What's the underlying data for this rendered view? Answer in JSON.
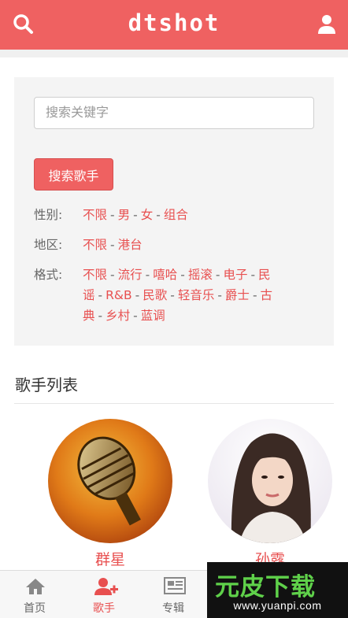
{
  "header": {
    "title": "dtshot"
  },
  "search": {
    "placeholder": "搜索关键字",
    "button_label": "搜索歌手"
  },
  "filters": {
    "gender": {
      "label": "性别:",
      "options": [
        "不限",
        "男",
        "女",
        "组合"
      ]
    },
    "region": {
      "label": "地区:",
      "options": [
        "不限",
        "港台"
      ]
    },
    "style": {
      "label": "格式:",
      "options": [
        "不限",
        "流行",
        "嘻哈",
        "摇滚",
        "电子",
        "民谣",
        "R&B",
        "民歌",
        "轻音乐",
        "爵士",
        "古典",
        "乡村",
        "蓝调"
      ]
    }
  },
  "singer_list": {
    "title": "歌手列表",
    "singers": [
      {
        "name": "群星"
      },
      {
        "name": "孙露"
      }
    ]
  },
  "bottom_nav": {
    "items": [
      {
        "label": "首页",
        "icon": "home-icon"
      },
      {
        "label": "歌手",
        "icon": "add-user-icon"
      },
      {
        "label": "专辑",
        "icon": "album-icon"
      }
    ],
    "active_index": 1
  },
  "watermark": {
    "text": "元皮下载",
    "url": "www.yuanpi.com"
  },
  "colors": {
    "accent": "#ef6161",
    "link": "#e85050",
    "panel_bg": "#f4f4f4"
  }
}
